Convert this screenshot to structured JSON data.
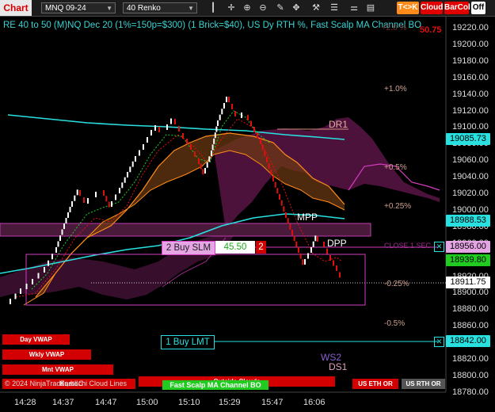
{
  "toolbar": {
    "chart_label": "Chart",
    "instrument": "MNQ 09-24",
    "bar_type": "40 Renko",
    "tk_label": "T<>K",
    "cloud_label": "Cloud",
    "barcol_label": "BarCol",
    "off_label": "Off",
    "icons": [
      "bar-chart-icon",
      "crosshair-icon",
      "zoom-in-icon",
      "zoom-out-icon",
      "pencil-icon",
      "drag-icon",
      "hammer-icon",
      "list-icon",
      "chart-style-icon",
      "order-icon"
    ]
  },
  "chart": {
    "title": "RE 40 to 50 (M)NQ Dec 20 (1%=150p=$300) (1 Brick=$40), US Dy RTH %, Fast Scalp MA Channel BO",
    "top_right_value": "50.75",
    "top_faded_label": "+2.0 %",
    "y_labels": [
      "19220.00",
      "19200.00",
      "19180.00",
      "19160.00",
      "19140.00",
      "19120.00",
      "19100.00",
      "19080.00",
      "19060.00",
      "19040.00",
      "19020.00",
      "19000.00",
      "18980.00",
      "18960.00",
      "18940.00",
      "18920.00",
      "18900.00",
      "18880.00",
      "18860.00",
      "18840.00",
      "18820.00",
      "18800.00",
      "18780.00"
    ],
    "x_labels": [
      "14:28",
      "14:37",
      "14:47",
      "15:00",
      "15:10",
      "15:29",
      "15:47",
      "16:06"
    ],
    "price_tags": {
      "cyan_upper": "19085.73",
      "cyan_lower": "18988.53",
      "pink": "18956.00",
      "green": "18939.80",
      "current": "18911.75",
      "limit": "18842.00"
    },
    "pct_labels": {
      "p1": "+1.0%",
      "p05": "+0.5%",
      "p025": "+0.25%",
      "m025": "-0.25%",
      "m05": "-0.5%"
    },
    "level_labels": {
      "dr1": "DR1",
      "mpp": "MPP",
      "dpp": "DPP",
      "ws2": "WS2",
      "ds1": "DS1",
      "close1sec": "CLOSE 1 SEC"
    },
    "orders": {
      "stop_label": "2 Buy SLM",
      "stop_price": "45.50",
      "stop_qty": "2",
      "limit_label": "1 Buy LMT"
    },
    "bottom_buttons": {
      "day_vwap": "Day VWAP",
      "wkly_vwap": "Wkly VWAP",
      "mnt_vwap": "Mnt VWAP",
      "kumo": "Kumo",
      "outside_clouds": "Outside Clouds",
      "fast_scalp": "Fast Scalp MA Channel BO",
      "us_eth_or": "US ETH OR",
      "us_rth_or": "US RTH OR"
    },
    "copyright": "© 2024 NinjaTrader, LLC",
    "fast_clouds": "Fast Ichi Cloud Lines",
    "colors": {
      "background": "#000000",
      "cyan": "#29e0e0",
      "green": "#21cc21",
      "red": "#e01010",
      "orange": "#ff8c1a",
      "cloud_purple": "#5b1545",
      "magenta": "#d43cc0"
    }
  }
}
